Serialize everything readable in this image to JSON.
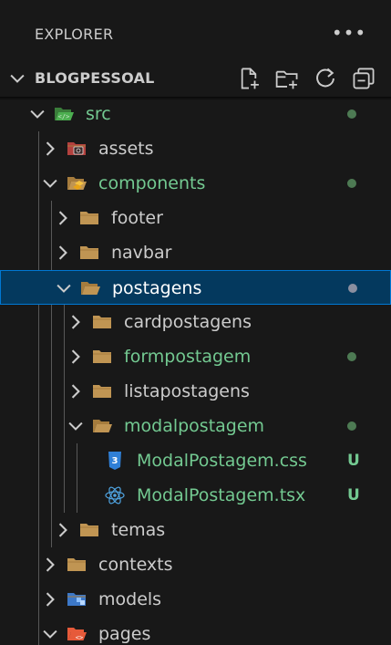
{
  "header": {
    "title": "EXPLORER",
    "more_label": "•••"
  },
  "section": {
    "title": "BLOGPESSOAL",
    "actions": [
      {
        "name": "new-file-icon"
      },
      {
        "name": "new-folder-icon"
      },
      {
        "name": "refresh-icon"
      },
      {
        "name": "collapse-all-icon"
      }
    ]
  },
  "colors": {
    "background": "#181818",
    "text": "#cccccc",
    "modified": "#73c991",
    "untracked": "#73c991",
    "dot_green": "#4d7a53",
    "dot_selected": "#8b8fa0",
    "selection_bg": "#04395e",
    "selection_border": "#0078d4",
    "folder": "#c09553"
  },
  "tree": [
    {
      "label": "src",
      "depth": 0,
      "expanded": true,
      "icon": "src-folder-icon",
      "color": "#73c991",
      "dot": true
    },
    {
      "label": "assets",
      "depth": 1,
      "expanded": false,
      "icon": "assets-folder-icon",
      "color": "#cccccc"
    },
    {
      "label": "components",
      "depth": 1,
      "expanded": true,
      "icon": "components-folder-icon",
      "color": "#73c991",
      "dot": true
    },
    {
      "label": "footer",
      "depth": 2,
      "expanded": false,
      "icon": "folder-icon",
      "color": "#cccccc"
    },
    {
      "label": "navbar",
      "depth": 2,
      "expanded": false,
      "icon": "folder-icon",
      "color": "#cccccc"
    },
    {
      "label": "postagens",
      "depth": 2,
      "expanded": true,
      "icon": "folder-open-icon",
      "color": "#ffffff",
      "dot": true,
      "selected": true
    },
    {
      "label": "cardpostagens",
      "depth": 3,
      "expanded": false,
      "icon": "folder-icon",
      "color": "#cccccc"
    },
    {
      "label": "formpostagem",
      "depth": 3,
      "expanded": false,
      "icon": "folder-icon",
      "color": "#73c991",
      "dot": true
    },
    {
      "label": "listapostagens",
      "depth": 3,
      "expanded": false,
      "icon": "folder-icon",
      "color": "#cccccc"
    },
    {
      "label": "modalpostagem",
      "depth": 3,
      "expanded": true,
      "icon": "folder-open-icon",
      "color": "#73c991",
      "dot": true
    },
    {
      "label": "ModalPostagem.css",
      "depth": 4,
      "file": true,
      "icon": "css-file-icon",
      "color": "#73c991",
      "badge": "U"
    },
    {
      "label": "ModalPostagem.tsx",
      "depth": 4,
      "file": true,
      "icon": "react-file-icon",
      "color": "#73c991",
      "badge": "U"
    },
    {
      "label": "temas",
      "depth": 2,
      "expanded": false,
      "icon": "folder-icon",
      "color": "#cccccc"
    },
    {
      "label": "contexts",
      "depth": 1,
      "expanded": false,
      "icon": "folder-icon",
      "color": "#cccccc"
    },
    {
      "label": "models",
      "depth": 1,
      "expanded": false,
      "icon": "models-folder-icon",
      "color": "#cccccc"
    },
    {
      "label": "pages",
      "depth": 1,
      "expanded": true,
      "icon": "pages-folder-icon",
      "color": "#cccccc"
    }
  ]
}
